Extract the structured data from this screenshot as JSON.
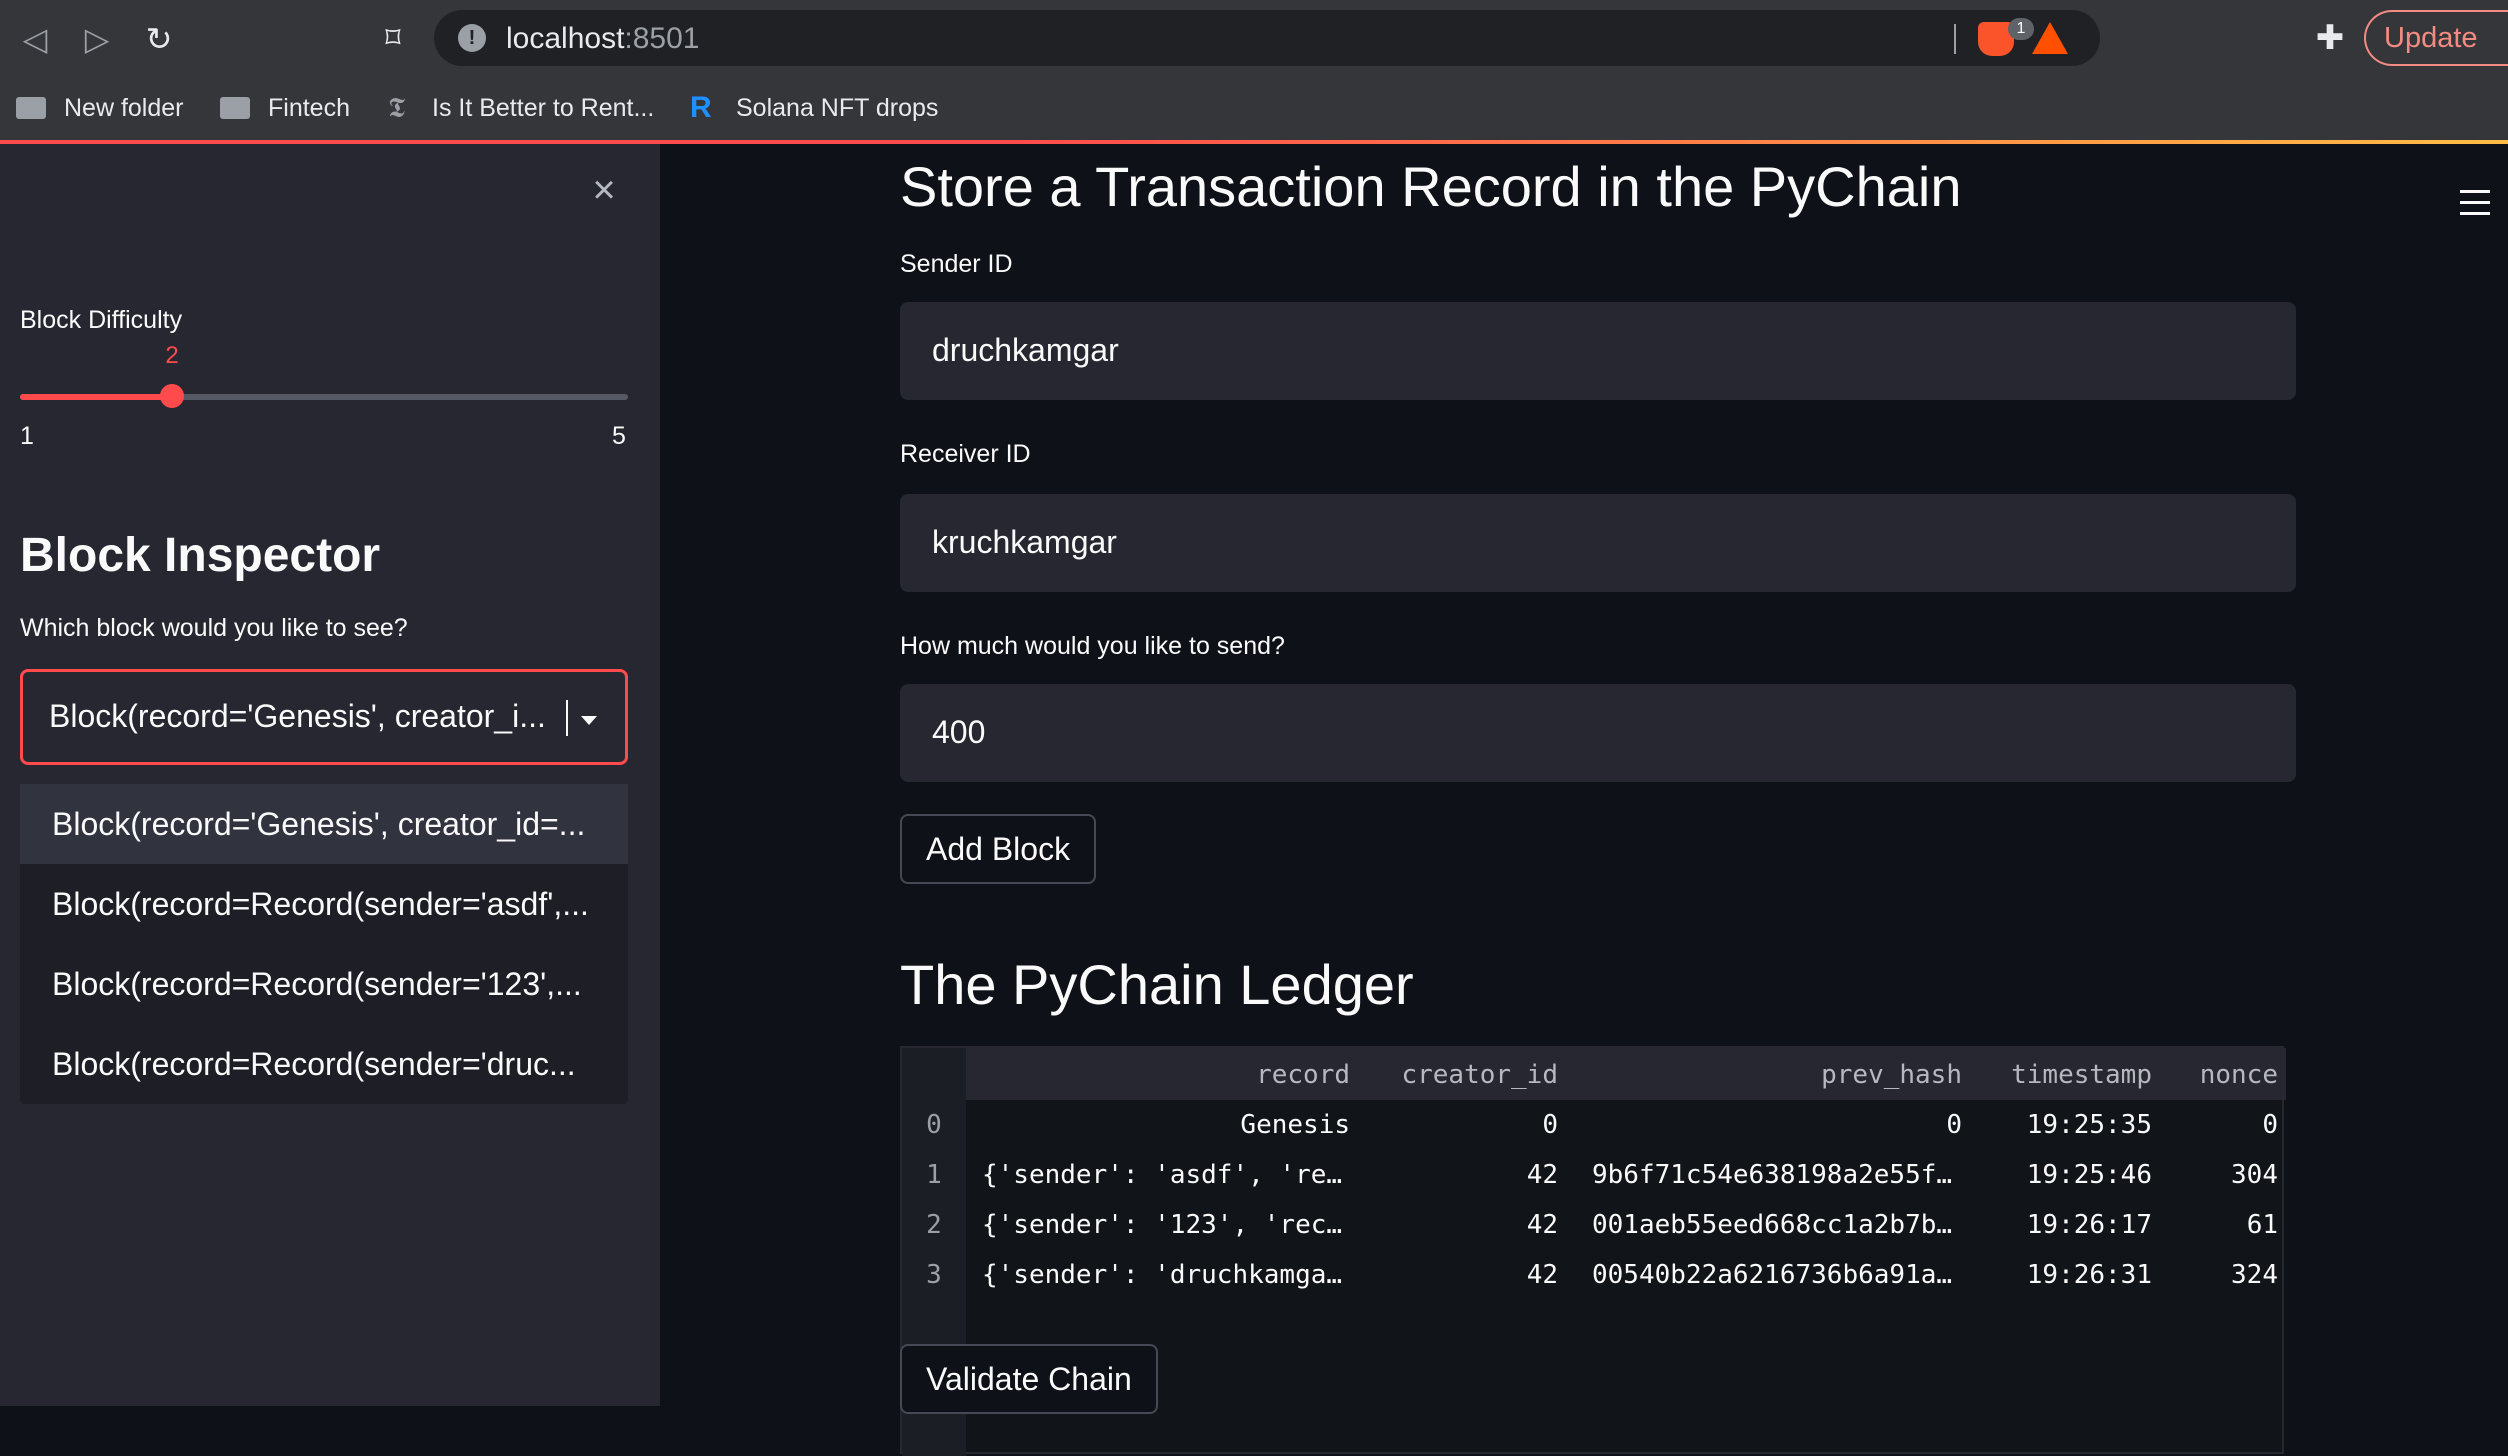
{
  "browser": {
    "url_host": "localhost",
    "url_port": ":8501",
    "brave_badge": "1",
    "update_label": "Update",
    "bookmarks": [
      "New folder",
      "Fintech",
      "Is It Better to Rent...",
      "Solana NFT drops"
    ]
  },
  "sidebar": {
    "slider": {
      "label": "Block Difficulty",
      "value": 2,
      "value_label": "2",
      "min": 1,
      "max": 5,
      "min_label": "1",
      "max_label": "5"
    },
    "inspector_heading": "Block Inspector",
    "inspector_prompt": "Which block would you like to see?",
    "selected_block": "Block(record='Genesis', creator_i...",
    "options": [
      "Block(record='Genesis', creator_id=...",
      "Block(record=Record(sender='asdf',...",
      "Block(record=Record(sender='123',...",
      "Block(record=Record(sender='druc..."
    ]
  },
  "main": {
    "title": "Store a Transaction Record in the PyChain",
    "sender_label": "Sender ID",
    "sender_value": "druchkamgar",
    "receiver_label": "Receiver ID",
    "receiver_value": "kruchkamgar",
    "amount_label": "How much would you like to send?",
    "amount_value": "400",
    "add_block_label": "Add Block",
    "ledger_title": "The PyChain Ledger",
    "validate_label": "Validate Chain"
  },
  "ledger": {
    "columns": [
      "record",
      "creator_id",
      "prev_hash",
      "timestamp",
      "nonce"
    ],
    "rows": [
      {
        "index": "0",
        "record": "Genesis",
        "creator_id": "0",
        "prev_hash": "0",
        "timestamp": "19:25:35",
        "nonce": "0"
      },
      {
        "index": "1",
        "record": "{'sender': 'asdf', 're…",
        "creator_id": "42",
        "prev_hash": "9b6f71c54e638198a2e55f…",
        "timestamp": "19:25:46",
        "nonce": "304"
      },
      {
        "index": "2",
        "record": "{'sender': '123', 'rec…",
        "creator_id": "42",
        "prev_hash": "001aeb55eed668cc1a2b7b…",
        "timestamp": "19:26:17",
        "nonce": "61"
      },
      {
        "index": "3",
        "record": "{'sender': 'druchkamga…",
        "creator_id": "42",
        "prev_hash": "00540b22a6216736b6a91a…",
        "timestamp": "19:26:31",
        "nonce": "324"
      }
    ]
  },
  "colors": {
    "accent": "#ff4b4b",
    "sidebar_bg": "#262730",
    "main_bg": "#0e1117"
  }
}
